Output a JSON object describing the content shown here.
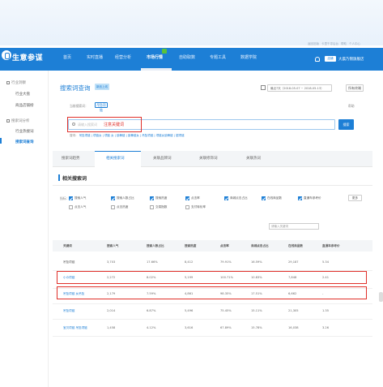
{
  "brand": {
    "name": "生意参谋"
  },
  "top_links": [
    "返回旧版",
    "卡里千寻后台",
    "帮助",
    "个人中心"
  ],
  "nav": {
    "items": [
      "首页",
      "实时直播",
      "经营分析",
      "市场行情",
      "自助取数",
      "专题工具",
      "数据学院"
    ],
    "active_index": 3,
    "store_tag": "店铺",
    "store_name": "大晨乃锦旗舰店"
  },
  "sidebar": {
    "groups": [
      {
        "label": "行业洞察",
        "items": [
          "行业大盘",
          "商品店铺榜"
        ]
      },
      {
        "label": "搜索词分析",
        "items": [
          "行业热搜词",
          "搜索词查询"
        ]
      }
    ],
    "active_item": "搜索词查询"
  },
  "page": {
    "title": "搜索词查询",
    "title_tag": "新品上线",
    "date_range": "最近7天（2018-05-07 ~ 2018-05-13）",
    "compare_button": "所有终端",
    "filter_label": "当前搜索词：",
    "filter_chip": "吊坠项链",
    "help_link": "帮助"
  },
  "search": {
    "placeholder": "请输入搜索词",
    "value": "注意关键词",
    "button": "搜索",
    "hot_label": "搜词：",
    "hot_words": [
      "吊坠项链",
      "项链女",
      "项链 女",
      "锁骨链",
      "锁骨链女",
      "吊坠项链",
      "项链女锁骨链",
      "银项链"
    ]
  },
  "tabs": [
    "搜索词趋势",
    "相关搜索词",
    "关联品牌词",
    "关联修饰词",
    "关联热词"
  ],
  "active_tab": 1,
  "section": {
    "title": "相关搜索词"
  },
  "metrics": {
    "label": "指标：",
    "row1": [
      {
        "label": "搜索人气",
        "on": true
      },
      {
        "label": "搜索人数占比",
        "on": true
      },
      {
        "label": "搜索热度",
        "on": true
      },
      {
        "label": "点击率",
        "on": true
      },
      {
        "label": "商城点击占比",
        "on": true
      },
      {
        "label": "在线商品数",
        "on": true
      },
      {
        "label": "直通车参考价",
        "on": true
      }
    ],
    "row2": [
      {
        "label": "点击人气",
        "on": false
      },
      {
        "label": "点击热度",
        "on": false
      },
      {
        "label": "交易指数",
        "on": false
      },
      {
        "label": "支付转化率",
        "on": false
      }
    ],
    "more_button": "更多",
    "search_placeholder": "请输入关键词"
  },
  "table": {
    "columns": [
      "关键词",
      "搜索人气",
      "搜索人数占比",
      "搜索热度",
      "点击率",
      "商城点击占比",
      "在线商品数",
      "直通车参考价"
    ],
    "rows": [
      [
        "吊坠项链",
        "3,703",
        "17.66%",
        "8,412",
        "79.91%",
        "16.59%",
        "29,187",
        "5.34"
      ],
      [
        "小众项链",
        "2,272",
        "8.02%",
        "5,199",
        "100.71%",
        "10.83%",
        "7,848",
        "2.41"
      ],
      [
        "吊坠项链 女吊坠",
        "2,179",
        "7.59%",
        "4,861",
        "98.35%",
        "17.51%",
        "6,662",
        "-"
      ],
      [
        "吊坠项链",
        "2,014",
        "6.87%",
        "5,496",
        "75.45%",
        "15.11%",
        "21,305",
        "1.35"
      ],
      [
        "宝贝项链 吊坠项链",
        "1,458",
        "4.12%",
        "3,616",
        "67.89%",
        "15.78%",
        "16,038",
        "3.26"
      ]
    ],
    "highlighted_rows": [
      1,
      2
    ]
  }
}
